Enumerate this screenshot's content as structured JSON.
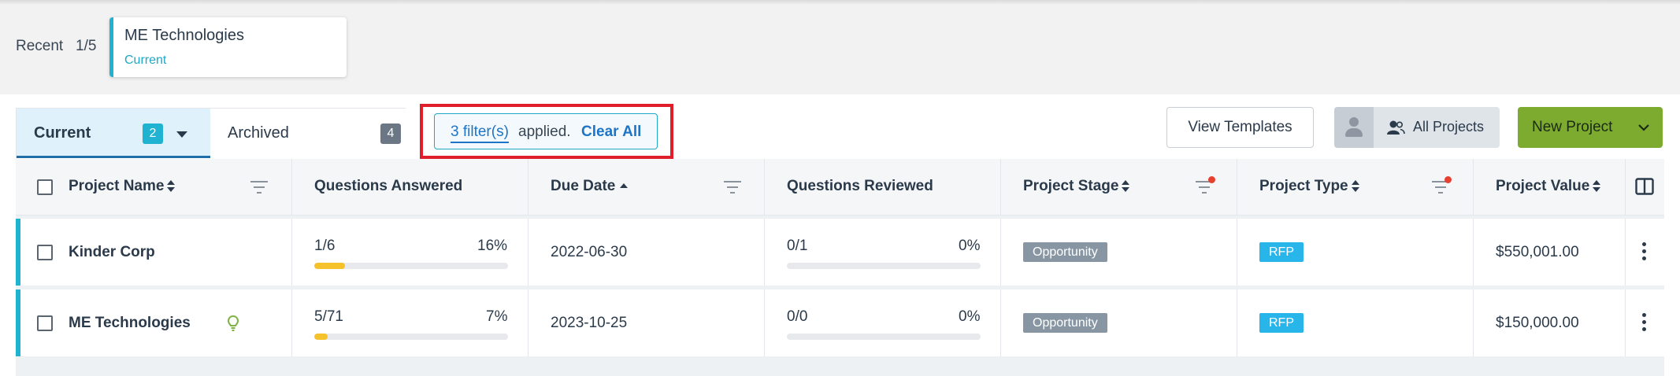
{
  "recent": {
    "label": "Recent",
    "count": "1/5",
    "card": {
      "name": "ME Technologies",
      "status": "Current"
    }
  },
  "tabs": [
    {
      "label": "Current",
      "badge": "2"
    },
    {
      "label": "Archived",
      "badge": "4"
    }
  ],
  "filter": {
    "count_text": "3 filter(s)",
    "applied_text": "applied.",
    "clear_label": "Clear All"
  },
  "actions": {
    "view_templates": "View Templates",
    "all_projects": "All Projects",
    "new_project": "New Project"
  },
  "table": {
    "columns": [
      "Project Name",
      "Questions Answered",
      "Due Date",
      "Questions Reviewed",
      "Project Stage",
      "Project Type",
      "Project Value"
    ],
    "rows": [
      {
        "name": "Kinder Corp",
        "answered": "1/6",
        "answered_pct": "16%",
        "answered_fraction": 0.16,
        "due": "2022-06-30",
        "reviewed": "0/1",
        "reviewed_pct": "0%",
        "reviewed_fraction": 0,
        "stage": "Opportunity",
        "type": "RFP",
        "value": "$550,001.00",
        "has_hint_icon": false
      },
      {
        "name": "ME Technologies",
        "answered": "5/71",
        "answered_pct": "7%",
        "answered_fraction": 0.07,
        "due": "2023-10-25",
        "reviewed": "0/0",
        "reviewed_pct": "0%",
        "reviewed_fraction": 0,
        "stage": "Opportunity",
        "type": "RFP",
        "value": "$150,000.00",
        "has_hint_icon": true
      }
    ]
  },
  "colors": {
    "accent": "#1fb3d1",
    "link": "#1e74c6",
    "highlight_border": "#e01d2a",
    "new_project_bg": "#7cab2f",
    "progress": "#f6c22c",
    "stage_tag": "#8896a3",
    "type_tag": "#27b5ea",
    "filter_dot": "#e8402f"
  }
}
